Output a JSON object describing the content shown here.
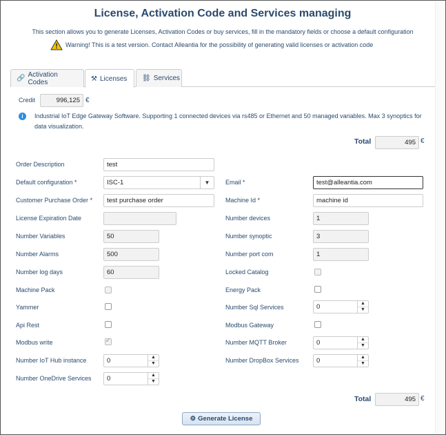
{
  "header": {
    "title": "License, Activation Code and Services managing",
    "subtitle": "This section allows you to generate Licenses, Activation Codes or buy services, fill in the mandatory fields or choose a default configuration",
    "warning": "Warning! This is a test version. Contact Alleantia for the possibility of generating valid licenses or activation code"
  },
  "tabs": [
    {
      "label": "Activation Codes",
      "icon": "link-icon"
    },
    {
      "label": "Licenses",
      "icon": "gavel-icon",
      "active": true
    },
    {
      "label": "Services",
      "icon": "chain-icon"
    }
  ],
  "credit": {
    "label": "Credit",
    "value": "996,125",
    "currency": "€"
  },
  "info_text": "Industrial IoT Edge Gateway Software. Supporting 1 connected devices via rs485 or Ethernet and 50 managed variables. Max 3 synoptics for data visualization.",
  "total_top": {
    "label": "Total",
    "value": "495",
    "currency": "€"
  },
  "total_bottom": {
    "label": "Total",
    "value": "495",
    "currency": "€"
  },
  "left_fields": {
    "order_description": {
      "label": "Order Description",
      "value": "test"
    },
    "default_configuration": {
      "label": "Default configuration *",
      "value": "ISC-1"
    },
    "customer_po": {
      "label": "Customer Purchase Order *",
      "value": "test purchase order"
    },
    "license_expiration": {
      "label": "License Expiration Date",
      "value": ""
    },
    "number_variables": {
      "label": "Number Variables",
      "value": "50"
    },
    "number_alarms": {
      "label": "Number Alarms",
      "value": "500"
    },
    "number_log_days": {
      "label": "Number log days",
      "value": "60"
    },
    "machine_pack": {
      "label": "Machine Pack"
    },
    "yammer": {
      "label": "Yammer"
    },
    "api_rest": {
      "label": "Api Rest"
    },
    "modbus_write": {
      "label": "Modbus write"
    },
    "iot_hub": {
      "label": "Number IoT Hub instance",
      "value": "0"
    },
    "onedrive": {
      "label": "Number OneDrive Services",
      "value": "0"
    }
  },
  "right_fields": {
    "email": {
      "label": "Email *",
      "value": "test@alleantia.com"
    },
    "machine_id": {
      "label": "Machine Id *",
      "value": "machine id"
    },
    "number_devices": {
      "label": "Number devices",
      "value": "1"
    },
    "number_synoptic": {
      "label": "Number synoptic",
      "value": "3"
    },
    "number_port_com": {
      "label": "Number port com",
      "value": "1"
    },
    "locked_catalog": {
      "label": "Locked Catalog"
    },
    "energy_pack": {
      "label": "Energy Pack"
    },
    "sql_services": {
      "label": "Number Sql Services",
      "value": "0"
    },
    "modbus_gateway": {
      "label": "Modbus Gateway"
    },
    "mqtt_broker": {
      "label": "Number MQTT Broker",
      "value": "0"
    },
    "dropbox": {
      "label": "Number DropBox Services",
      "value": "0"
    }
  },
  "generate_button": {
    "label": "Generate License",
    "icon": "gears-icon"
  },
  "colors": {
    "text": "#2a4a6e",
    "info": "#2a8ee0",
    "warning": "#f5c400"
  }
}
